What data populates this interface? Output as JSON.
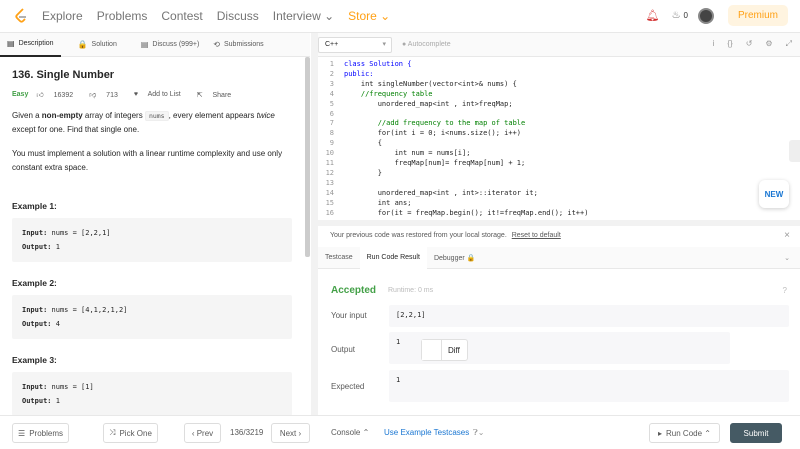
{
  "nav": {
    "items": [
      "Explore",
      "Problems",
      "Contest",
      "Discuss",
      "Interview ⌄",
      "Store ⌄"
    ],
    "fire_count": "0",
    "premium_label": "Premium"
  },
  "tabs": [
    {
      "icon": "▤",
      "label": "Description"
    },
    {
      "icon": "🔒",
      "label": "Solution"
    },
    {
      "icon": "▤",
      "label": "Discuss (999+)"
    },
    {
      "icon": "⟲",
      "label": "Submissions"
    }
  ],
  "problem": {
    "title": "136. Single Number",
    "difficulty": "Easy",
    "likes": "16392",
    "dislikes": "713",
    "add_to_list": "Add to List",
    "share": "Share",
    "p1_a": "Given a ",
    "p1_b": "non-empty",
    "p1_c": " array of integers ",
    "p1_code": "nums",
    "p1_d": ", every element appears ",
    "p1_e": "twice",
    "p1_f": " except for one. Find that single one.",
    "p2": "You must implement a solution with a linear runtime complexity and use only constant extra space.",
    "examples": [
      {
        "title": "Example 1:",
        "input": "nums = [2,2,1]",
        "output": "1"
      },
      {
        "title": "Example 2:",
        "input": "nums = [4,1,2,1,2]",
        "output": "4"
      },
      {
        "title": "Example 3:",
        "input": "nums = [1]",
        "output": "1"
      }
    ],
    "input_label": "Input:",
    "output_label": "Output:"
  },
  "editor": {
    "language": "C++",
    "autocomplete": "Autocomplete",
    "lines": [
      {
        "n": "1",
        "t": "class Solution {",
        "c": "kw"
      },
      {
        "n": "2",
        "t": "public:",
        "c": "kw"
      },
      {
        "n": "3",
        "t": "    int singleNumber(vector<int>& nums) {",
        "c": ""
      },
      {
        "n": "4",
        "t": "    //frequency table",
        "c": "cm"
      },
      {
        "n": "5",
        "t": "        unordered_map<int , int>freqMap;",
        "c": ""
      },
      {
        "n": "6",
        "t": "",
        "c": ""
      },
      {
        "n": "7",
        "t": "        //add frequency to the map of table",
        "c": "cm"
      },
      {
        "n": "8",
        "t": "        for(int i = 0; i<nums.size(); i++)",
        "c": ""
      },
      {
        "n": "9",
        "t": "        {",
        "c": ""
      },
      {
        "n": "10",
        "t": "            int num = nums[i];",
        "c": ""
      },
      {
        "n": "11",
        "t": "            freqMap[num]= freqMap[num] + 1;",
        "c": ""
      },
      {
        "n": "12",
        "t": "        }",
        "c": ""
      },
      {
        "n": "13",
        "t": "",
        "c": ""
      },
      {
        "n": "14",
        "t": "        unordered_map<int , int>::iterator it;",
        "c": ""
      },
      {
        "n": "15",
        "t": "        int ans;",
        "c": ""
      },
      {
        "n": "16",
        "t": "        for(it = freqMap.begin(); it!=freqMap.end(); it++)",
        "c": ""
      }
    ],
    "new_badge": "NEW"
  },
  "restore": {
    "text": "Your previous code was restored from your local storage.",
    "link": "Reset to default"
  },
  "result_tabs": [
    "Testcase",
    "Run Code Result",
    "Debugger 🔒"
  ],
  "result": {
    "status": "Accepted",
    "runtime": "Runtime: 0 ms",
    "your_input_label": "Your input",
    "your_input": "[2,2,1]",
    "output_label": "Output",
    "output": "1",
    "expected_label": "Expected",
    "expected": "1",
    "diff_label": "Diff"
  },
  "bottom": {
    "problems": "Problems",
    "pick_one": "Pick One",
    "prev": "‹ Prev",
    "page": "136/3219",
    "next": "Next ›",
    "console": "Console ⌃",
    "use_example": "Use Example Testcases",
    "run_code": "Run Code ⌃",
    "submit": "Submit"
  }
}
